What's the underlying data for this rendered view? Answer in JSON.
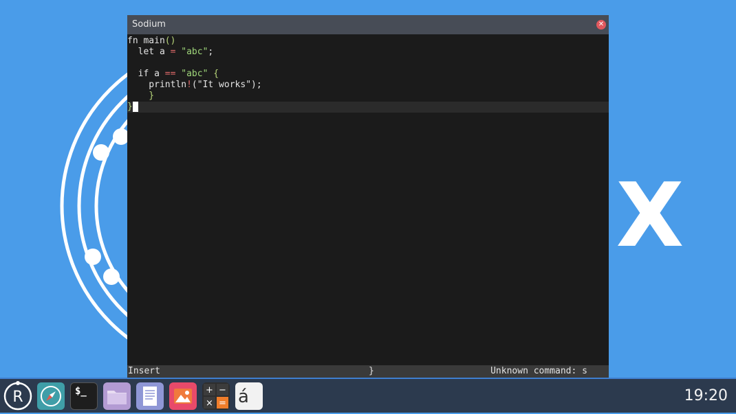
{
  "window": {
    "title": "Sodium"
  },
  "editor": {
    "lines": [
      "fn main()",
      "  let a = \"abc\";",
      "",
      "  if a == \"abc\" {",
      "    println!(\"It works\");",
      "    }",
      "}"
    ]
  },
  "statusbar": {
    "mode": "Insert",
    "char": "}",
    "message": "Unknown command: s"
  },
  "wallpaper": {
    "logo_letter": "X"
  },
  "taskbar": {
    "launcher_letter": "R",
    "terminal_label": "$_",
    "charmap_label": "á",
    "clock": "19:20",
    "apps": [
      "browser-icon",
      "terminal-icon",
      "file-manager-icon",
      "text-editor-icon",
      "image-viewer-icon",
      "calculator-icon",
      "character-map-icon"
    ]
  },
  "colors": {
    "desktop": "#4a9ce9",
    "titlebar": "#474c56",
    "editor_bg": "#1b1b1b",
    "taskbar": "#2c3a4e",
    "close_button": "#e0585e"
  }
}
